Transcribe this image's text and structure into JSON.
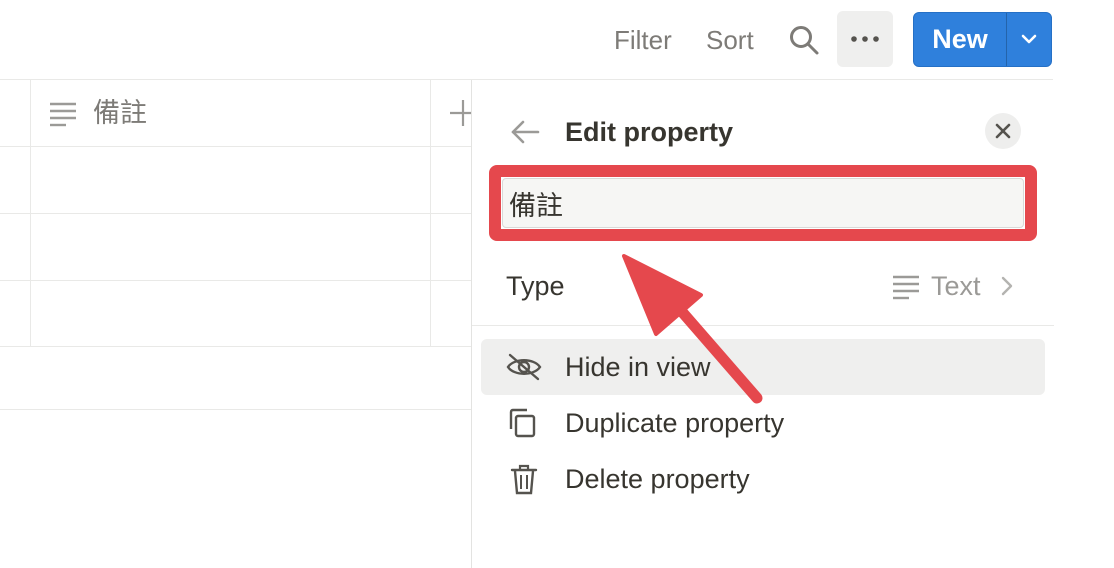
{
  "toolbar": {
    "filter_label": "Filter",
    "sort_label": "Sort",
    "search_icon": "search-icon",
    "more_icon": "more-horizontal-icon",
    "new_label": "New",
    "new_dropdown_icon": "chevron-down-icon",
    "accent_color": "#2f80dc"
  },
  "table": {
    "column_header": {
      "icon": "text-lines-icon",
      "label": "備註"
    },
    "add_column_icon": "plus-icon"
  },
  "edit_property": {
    "title": "Edit property",
    "back_icon": "arrow-left-icon",
    "close_icon": "close-icon",
    "name_value": "備註",
    "type_label": "Type",
    "type_value": "Text",
    "type_icon": "text-lines-icon",
    "menu": [
      {
        "label": "Hide in view",
        "icon": "eye-slash-icon"
      },
      {
        "label": "Duplicate property",
        "icon": "duplicate-icon"
      },
      {
        "label": "Delete property",
        "icon": "trash-icon"
      }
    ]
  },
  "annotation": {
    "color": "#e5484d",
    "shape": "highlight box with arrow"
  }
}
